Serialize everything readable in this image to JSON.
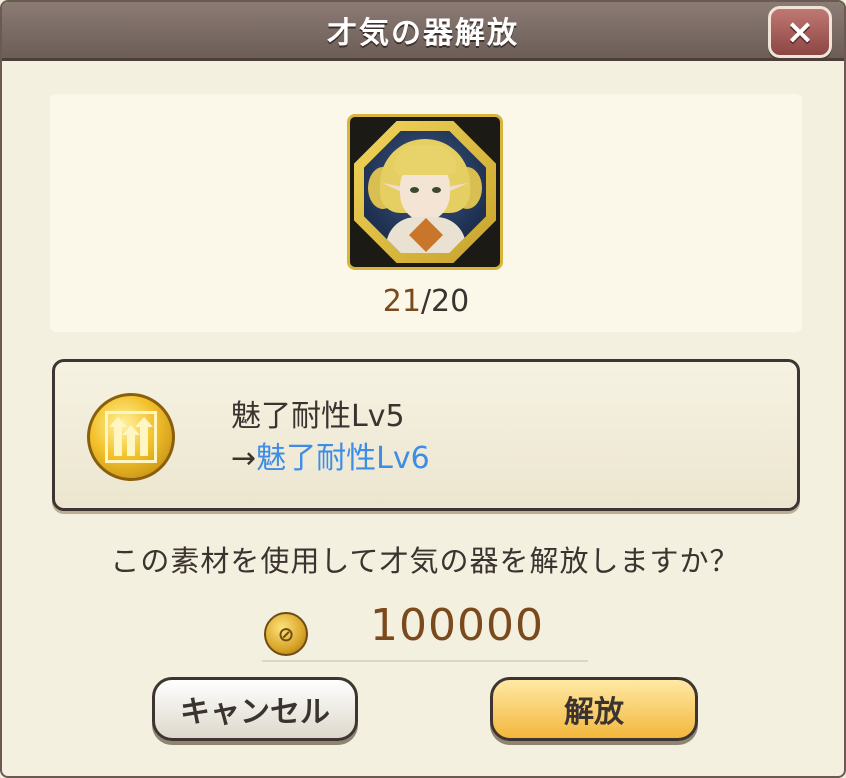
{
  "dialog": {
    "title": "才気の器解放",
    "close_icon": "×"
  },
  "material": {
    "count_current": "21",
    "count_required": "/20"
  },
  "skill": {
    "current": "魅了耐性Lv5",
    "arrow": "→",
    "next": "魅了耐性Lv6"
  },
  "confirm": {
    "question": "この素材を使用して才気の器を解放しますか？",
    "cost": "100000"
  },
  "buttons": {
    "cancel_label": "キャンセル",
    "release_label": "解放"
  },
  "colors": {
    "title_bar": "#7a6b65",
    "next_skill": "#3d8de8",
    "count_current": "#7a4a1d",
    "release_button": "#f3b73c"
  }
}
